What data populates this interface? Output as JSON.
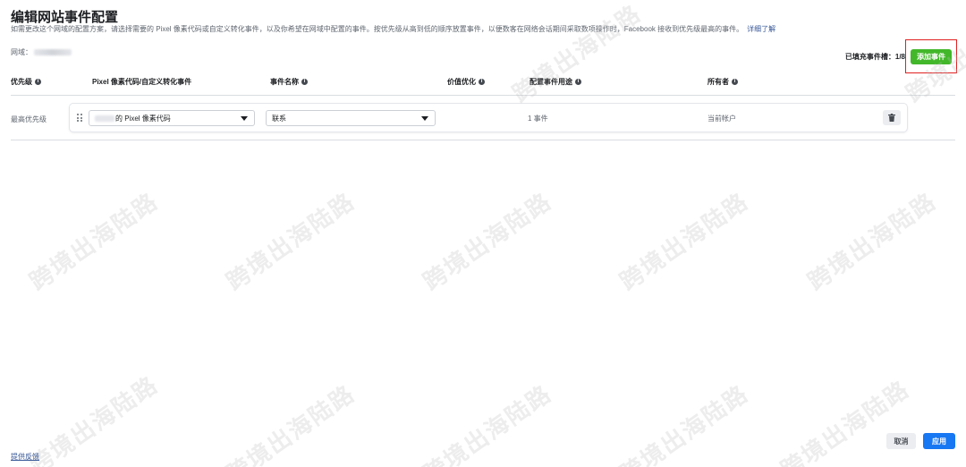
{
  "header": {
    "title": "编辑网站事件配置",
    "subtitle": "如需更改这个网域的配置方案，请选择需要的 Pixel 像素代码或自定义转化事件，以及你希望在网域中配置的事件。按优先级从高到低的顺序放置事件，以便数客在网络会话期间采取数项操作时，Facebook 接收到优先级最高的事件。",
    "learn_more": "详细了解",
    "domain_label": "网域："
  },
  "slots": {
    "label": "已填充事件槽：1/8",
    "add_button": "添加事件"
  },
  "table": {
    "columns": [
      "优先级",
      "Pixel 像素代码/自定义转化事件",
      "事件名称",
      "价值优化",
      "配置事件用途",
      "所有者"
    ],
    "rows": [
      {
        "priority": "最高优先级",
        "pixel": "的 Pixel 像素代码",
        "event": "联系",
        "usage": "1 事件",
        "owner": "当前帐户"
      }
    ]
  },
  "footer": {
    "feedback": "提供反馈",
    "cancel": "取消",
    "apply": "应用"
  },
  "watermark": "跨境出海陆路",
  "colors": {
    "add_button": "#42b72a",
    "apply_button": "#1877f2",
    "highlight_box": "#e02020",
    "link": "#385898"
  },
  "icons": [
    "info-icon",
    "drag-handle-icon",
    "chevron-down-icon",
    "trash-icon"
  ]
}
